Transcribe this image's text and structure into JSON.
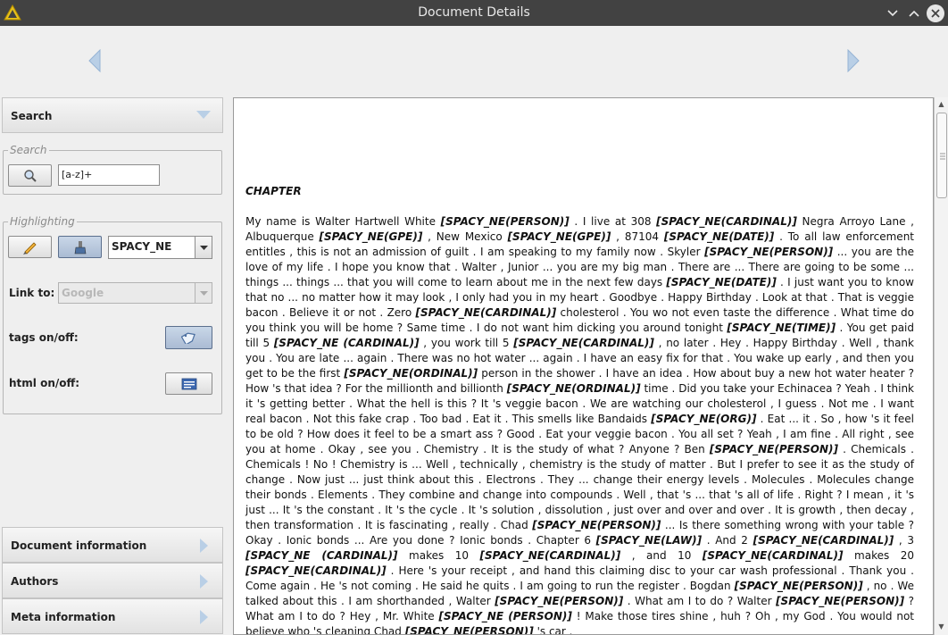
{
  "window": {
    "title": "Document Details"
  },
  "accordion": {
    "search": "Search",
    "document_information": "Document information",
    "authors": "Authors",
    "meta_information": "Meta information"
  },
  "search_group": {
    "legend": "Search",
    "query_value": "[a-z]+"
  },
  "highlighting": {
    "legend": "Highlighting",
    "selected_tagset": "SPACY_NE",
    "link_to_label": "Link to:",
    "link_to_value": "Google",
    "tags_toggle_label": "tags on/off:",
    "html_toggle_label": "html on/off:"
  },
  "document": {
    "heading": "CHAPTER",
    "segments": [
      {
        "t": "My name is Walter Hartwell White "
      },
      {
        "t": "[SPACY_NE(PERSON)]",
        "tag": true
      },
      {
        "t": " . I live at 308 "
      },
      {
        "t": "[SPACY_NE(CARDINAL)]",
        "tag": true
      },
      {
        "t": " Negra Arroyo Lane , Albuquerque "
      },
      {
        "t": "[SPACY_NE(GPE)]",
        "tag": true
      },
      {
        "t": " , New Mexico "
      },
      {
        "t": "[SPACY_NE(GPE)]",
        "tag": true
      },
      {
        "t": " , 87104 "
      },
      {
        "t": "[SPACY_NE(DATE)]",
        "tag": true
      },
      {
        "t": " . To all law enforcement entitles , this is not an admission of guilt . I am speaking to my family now . Skyler "
      },
      {
        "t": "[SPACY_NE(PERSON)]",
        "tag": true
      },
      {
        "t": " ... you are the love of my life . I hope you know that . Walter , Junior ... you are my big man . There are ... There are going to be some ... things ... things ... that you will come to learn about me in the next few days "
      },
      {
        "t": "[SPACY_NE(DATE)]",
        "tag": true
      },
      {
        "t": " . I just want you to know that no ... no matter how it may look , I only had you in my heart . Goodbye . Happy Birthday . Look at that . That is veggie bacon . Believe it or not . Zero "
      },
      {
        "t": "[SPACY_NE(CARDINAL)]",
        "tag": true
      },
      {
        "t": " cholesterol . You wo not even taste the difference . What time do you think you will be home ? Same time . I do not want him dicking you around tonight "
      },
      {
        "t": "[SPACY_NE(TIME)]",
        "tag": true
      },
      {
        "t": " . You get paid till 5 "
      },
      {
        "t": "[SPACY_NE (CARDINAL)]",
        "tag": true
      },
      {
        "t": " , you work till 5 "
      },
      {
        "t": "[SPACY_NE(CARDINAL)]",
        "tag": true
      },
      {
        "t": " , no later . Hey .   Happy Birthday .   Well , thank you . You are late ... again . There was no hot water ... again . I have an easy fix for that . You wake up early , and then you get to be the first "
      },
      {
        "t": "[SPACY_NE(ORDINAL)]",
        "tag": true
      },
      {
        "t": " person in the shower . I have an idea . How about buy a new hot water heater ? How 's that idea ? For the millionth and billionth "
      },
      {
        "t": "[SPACY_NE(ORDINAL)]",
        "tag": true
      },
      {
        "t": " time .   Did you take your Echinacea ?   Yeah . I think it 's getting better . What the hell is this ? It 's veggie bacon . We are watching our cholesterol , I guess . Not me . I want real bacon . Not this fake crap . Too bad . Eat it . This smells like Bandaids "
      },
      {
        "t": "[SPACY_NE(ORG)]",
        "tag": true
      },
      {
        "t": " . Eat ... it . So , how 's it feel to be old ? How does it feel to be a smart ass ? Good . Eat your veggie bacon .   You all set ?   Yeah , I am fine .   All right , see you at home .   Okay , see you . Chemistry . It is the study of what ? Anyone ? Ben "
      },
      {
        "t": "[SPACY_NE(PERSON)]",
        "tag": true
      },
      {
        "t": " .   Chemicals . Chemicals ! No ! Chemistry is ... Well , technically , chemistry is the study of matter . But I prefer to see it as the study of change . Now just ... just think about this . Electrons . They ... change their energy levels . Molecules . Molecules change their bonds . Elements . They combine and change into compounds . Well , that 's ... that 's all of life . Right ? I mean , it 's just ... It 's the constant . It 's the cycle . It 's solution , dissolution , just over and over and over . It is growth , then decay , then transformation . It is fascinating , really . Chad "
      },
      {
        "t": "[SPACY_NE(PERSON)]",
        "tag": true
      },
      {
        "t": " ... Is there something wrong with your table ? Okay . Ionic bonds ... Are you done ? Ionic bonds . Chapter 6 "
      },
      {
        "t": "[SPACY_NE(LAW)]",
        "tag": true
      },
      {
        "t": " . And 2 "
      },
      {
        "t": "[SPACY_NE(CARDINAL)]",
        "tag": true
      },
      {
        "t": " , 3 "
      },
      {
        "t": "[SPACY_NE (CARDINAL)]",
        "tag": true
      },
      {
        "t": " makes 10 "
      },
      {
        "t": "[SPACY_NE(CARDINAL)]",
        "tag": true
      },
      {
        "t": " , and 10 "
      },
      {
        "t": "[SPACY_NE(CARDINAL)]",
        "tag": true
      },
      {
        "t": " makes 20 "
      },
      {
        "t": "[SPACY_NE(CARDINAL)]",
        "tag": true
      },
      {
        "t": " . Here 's your receipt , and hand this claiming disc to your car wash professional . Thank you . Come again . He 's not coming . He said he quits . I am going to run the register . Bogdan "
      },
      {
        "t": "[SPACY_NE(PERSON)]",
        "tag": true
      },
      {
        "t": " , no . We talked about this . I am shorthanded , Walter "
      },
      {
        "t": "[SPACY_NE(PERSON)]",
        "tag": true
      },
      {
        "t": " . What am I to do ? Walter "
      },
      {
        "t": "[SPACY_NE(PERSON)]",
        "tag": true
      },
      {
        "t": " ? What am I to do ? Hey , Mr. White "
      },
      {
        "t": "[SPACY_NE (PERSON)]",
        "tag": true
      },
      {
        "t": " ! Make those tires shine , huh ? Oh , my God . You would not believe who 's cleaning Chad "
      },
      {
        "t": "[SPACY_NE(PERSON)]",
        "tag": true
      },
      {
        "t": " 's car ."
      }
    ]
  }
}
